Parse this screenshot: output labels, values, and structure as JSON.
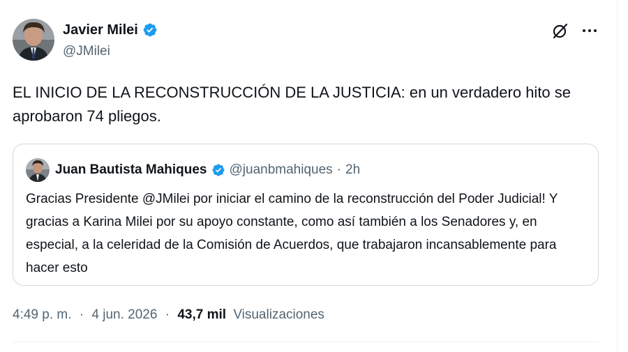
{
  "author": {
    "name": "Javier Milei",
    "handle": "@JMilei",
    "verified": true
  },
  "tweet": {
    "text": "EL INICIO DE LA RECONSTRUCCIÓN DE LA JUSTICIA: en un verdadero hito se aprobaron 74 pliegos."
  },
  "quoted": {
    "name": "Juan Bautista Mahiques",
    "handle": "@juanbmahiques",
    "separator": "·",
    "time": "2h",
    "verified": true,
    "text": "Gracias Presidente @JMilei por iniciar el camino de la reconstrucción del Poder Judicial! Y gracias a Karina Milei por su apoyo constante, como así también a los Senadores y, en especial, a la celeridad de la Comisión de Acuerdos, que trabajaron incansablemente para hacer esto"
  },
  "meta": {
    "time": "4:49 p. m.",
    "separator": "·",
    "date": "4 jun. 2026",
    "views_count": "43,7 mil",
    "views_label": "Visualizaciones"
  },
  "icons": {
    "verified": "verified-badge-icon",
    "grok": "grok-icon",
    "more": "more-icon"
  },
  "colors": {
    "verified_blue": "#1d9bf0",
    "text_primary": "#0f1419",
    "text_secondary": "#536471",
    "border": "#cfd9de"
  }
}
